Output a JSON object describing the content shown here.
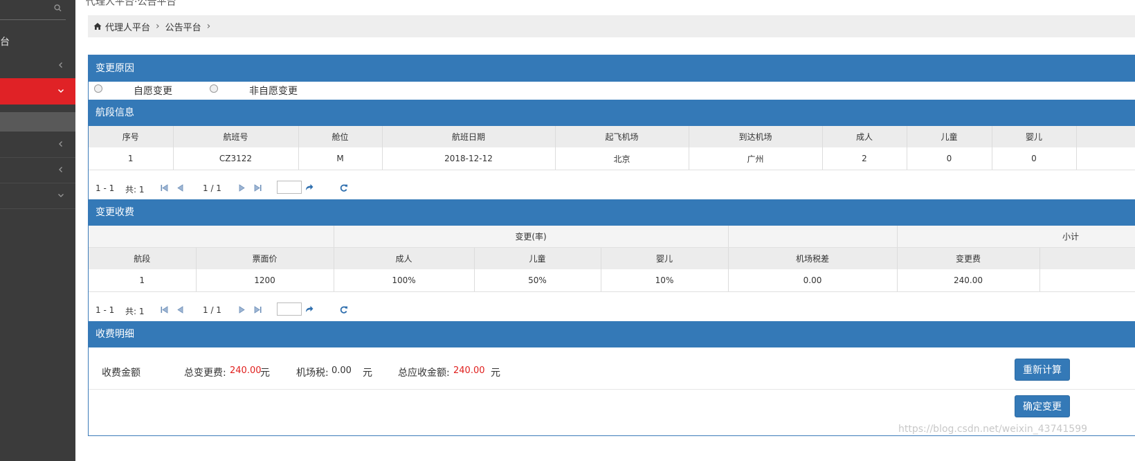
{
  "top": {
    "title": "代理人平台·公告平台"
  },
  "sidebar": {
    "title": "台"
  },
  "breadcrumb": {
    "items": [
      "代理人平台",
      "公告平台"
    ],
    "separator": "›"
  },
  "change_reason": {
    "header": "变更原因",
    "options": [
      "自愿变更",
      "非自愿变更"
    ]
  },
  "segment_info": {
    "header": "航段信息",
    "columns": [
      "序号",
      "航班号",
      "舱位",
      "航班日期",
      "起飞机场",
      "到达机场",
      "成人",
      "儿童",
      "婴儿"
    ],
    "rows": [
      [
        "1",
        "CZ3122",
        "M",
        "2018-12-12",
        "北京",
        "广州",
        "2",
        "0",
        "0"
      ]
    ],
    "pager": {
      "range": "1 - 1",
      "total": "共: 1",
      "page": "1 / 1"
    }
  },
  "change_fee": {
    "header": "变更收费",
    "group_headers": [
      "变更(率)",
      "小计"
    ],
    "columns": [
      "航段",
      "票面价",
      "成人",
      "儿童",
      "婴儿",
      "机场税差",
      "变更费"
    ],
    "rows": [
      [
        "1",
        "1200",
        "100%",
        "50%",
        "10%",
        "0.00",
        "240.00"
      ]
    ],
    "pager": {
      "range": "1 - 1",
      "total": "共: 1",
      "page": "1 / 1"
    }
  },
  "fee_detail": {
    "header": "收费明细",
    "label": "收费金额",
    "total_change_label": "总变更费:",
    "total_change_value": "240.00",
    "airport_tax_label": "机场税:",
    "airport_tax_value": "0.00",
    "total_due_label": "总应收金额:",
    "total_due_value": "240.00",
    "unit": "元",
    "recalc_button": "重新计算",
    "confirm_button": "确定变更"
  },
  "watermark": "https://blog.csdn.net/weixin_43741599",
  "colors": {
    "header_blue": "#3479b7",
    "active_red": "#e02226",
    "sidebar": "#3b3b3b",
    "amount_red": "#e0201e"
  }
}
